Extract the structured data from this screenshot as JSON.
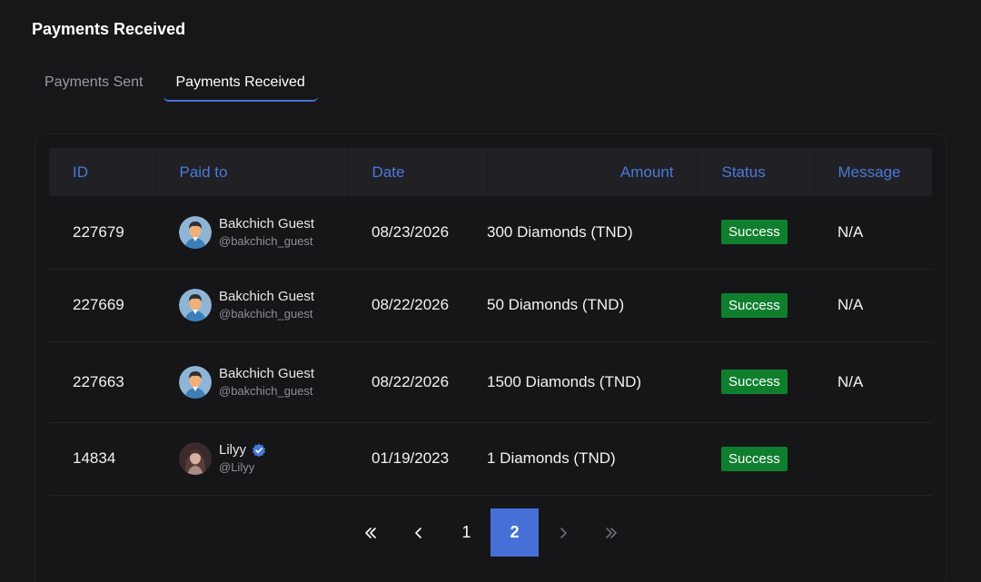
{
  "page": {
    "title": "Payments Received"
  },
  "tabs": [
    {
      "label": "Payments Sent",
      "active": false
    },
    {
      "label": "Payments Received",
      "active": true
    }
  ],
  "table": {
    "headers": {
      "id": "ID",
      "paid_to": "Paid to",
      "date": "Date",
      "amount": "Amount",
      "status": "Status",
      "message": "Message"
    },
    "rows": [
      {
        "id": "227679",
        "name": "Bakchich Guest",
        "handle": "@bakchich_guest",
        "verified": false,
        "date": "08/23/2026",
        "amount": "300 Diamonds (TND)",
        "status": "Success",
        "message": "N/A"
      },
      {
        "id": "227669",
        "name": "Bakchich Guest",
        "handle": "@bakchich_guest",
        "verified": false,
        "date": "08/22/2026",
        "amount": "50 Diamonds (TND)",
        "status": "Success",
        "message": "N/A"
      },
      {
        "id": "227663",
        "name": "Bakchich Guest",
        "handle": "@bakchich_guest",
        "verified": false,
        "date": "08/22/2026",
        "amount": "1500 Diamonds (TND)",
        "status": "Success",
        "message": "N/A"
      },
      {
        "id": "14834",
        "name": "Lilyy",
        "handle": "@Lilyy",
        "verified": true,
        "date": "01/19/2023",
        "amount": "1 Diamonds (TND)",
        "status": "Success",
        "message": ""
      }
    ]
  },
  "pagination": {
    "first_icon": "double-chevron-left-icon",
    "prev_icon": "chevron-left-icon",
    "pages": [
      "1",
      "2"
    ],
    "current": "2",
    "next_icon": "chevron-right-icon",
    "last_icon": "double-chevron-right-icon"
  },
  "colors": {
    "accent": "#4670d6",
    "header_text": "#4a78db",
    "success": "#0f7f2e",
    "background": "#17171a"
  }
}
